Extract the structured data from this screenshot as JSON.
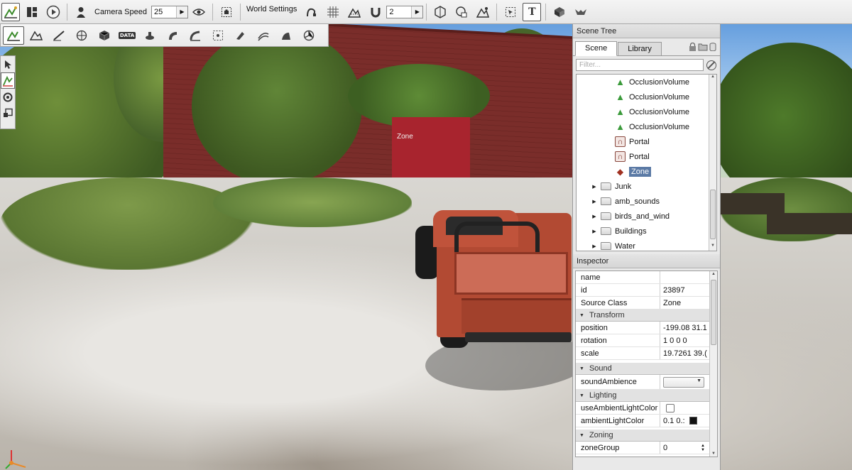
{
  "toolbar": {
    "camera_speed_label": "Camera Speed",
    "camera_speed_value": "25",
    "world_settings_label": "World Settings",
    "snap_value": "2"
  },
  "toolbar2": {
    "datablock_badge": "DATA"
  },
  "viewport": {
    "zone_label": "Zone"
  },
  "scene_tree": {
    "title": "Scene Tree",
    "tabs": [
      "Scene",
      "Library"
    ],
    "active_tab": "Scene",
    "filter_placeholder": "Filter...",
    "items": [
      {
        "label": "OcclusionVolume",
        "icon": "occlusion-volume-icon",
        "level": 2
      },
      {
        "label": "OcclusionVolume",
        "icon": "occlusion-volume-icon",
        "level": 2
      },
      {
        "label": "OcclusionVolume",
        "icon": "occlusion-volume-icon",
        "level": 2
      },
      {
        "label": "OcclusionVolume",
        "icon": "occlusion-volume-icon",
        "level": 2
      },
      {
        "label": "Portal",
        "icon": "portal-icon",
        "level": 2
      },
      {
        "label": "Portal",
        "icon": "portal-icon",
        "level": 2
      },
      {
        "label": "Zone",
        "icon": "zone-icon",
        "level": 2,
        "selected": true
      },
      {
        "label": "Junk",
        "icon": "folder-icon",
        "level": 1,
        "collapsed": true
      },
      {
        "label": "amb_sounds",
        "icon": "folder-icon",
        "level": 1,
        "collapsed": true
      },
      {
        "label": "birds_and_wind",
        "icon": "folder-icon",
        "level": 1,
        "collapsed": true
      },
      {
        "label": "Buildings",
        "icon": "folder-icon",
        "level": 1,
        "collapsed": true
      },
      {
        "label": "Water",
        "icon": "folder-icon",
        "level": 1,
        "collapsed": true
      }
    ]
  },
  "inspector": {
    "title": "Inspector",
    "name_label": "name",
    "name_value": "",
    "id_label": "id",
    "id_value": "23897",
    "source_class_label": "Source Class",
    "source_class_value": "Zone",
    "transform_group": "Transform",
    "position_label": "position",
    "position_value": "-199.08 31.1",
    "rotation_label": "rotation",
    "rotation_value": "1 0 0 0",
    "scale_label": "scale",
    "scale_value": "19.7261 39.(",
    "sound_group": "Sound",
    "sound_ambience_label": "soundAmbience",
    "lighting_group": "Lighting",
    "use_ambient_label": "useAmbientLightColor",
    "use_ambient_checked": false,
    "ambient_color_label": "ambientLightColor",
    "ambient_color_value": "0.1 0.:",
    "ambient_color_swatch": "#111111",
    "zoning_group": "Zoning",
    "zone_group_label": "zoneGroup",
    "zone_group_value": "0"
  },
  "colors": {
    "selection": "#5b7aa5",
    "occlusion_icon": "#3a9a3a",
    "portal_icon": "#7a2f25"
  }
}
